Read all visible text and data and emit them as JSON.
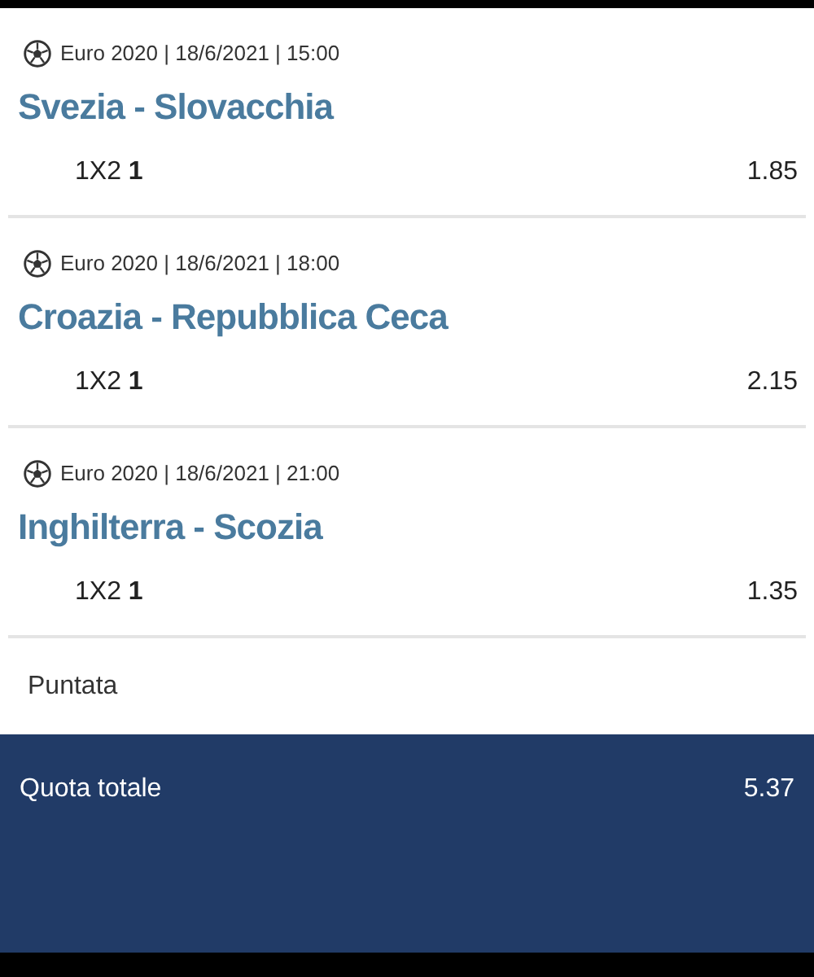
{
  "bets": [
    {
      "meta": "Euro 2020 | 18/6/2021 | 15:00",
      "match": "Svezia - Slovacchia",
      "pick": "1X2 **1**",
      "odds": "1.85"
    },
    {
      "meta": "Euro 2020 | 18/6/2021 | 18:00",
      "match": "Croazia - Repubblica Ceca",
      "pick": "1X2 **1**",
      "odds": "2.15"
    },
    {
      "meta": "Euro 2020 | 18/6/2021 | 21:00",
      "match": "Inghilterra - Scozia",
      "pick": "1X2 **1**",
      "odds": "1.35"
    }
  ],
  "stake": {
    "label": "Puntata"
  },
  "total": {
    "label": "Quota totale",
    "value": "5.37"
  }
}
